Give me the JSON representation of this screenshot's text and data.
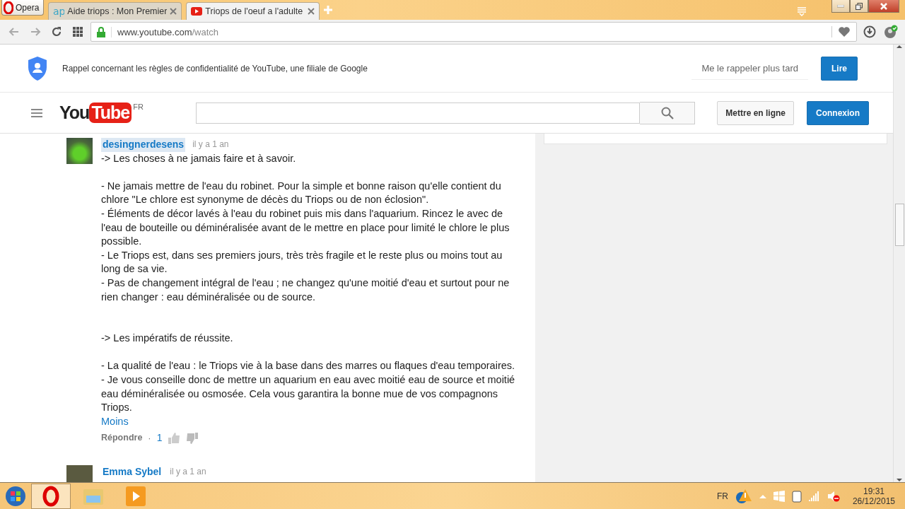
{
  "browser": {
    "menu_label": "Opera",
    "tabs": [
      {
        "title": "Aide triops : Mon Premier",
        "selected": false,
        "kind": "letters",
        "logo_text": "ap"
      },
      {
        "title": "Triops de l'oeuf a l'adulte",
        "selected": true,
        "kind": "video"
      }
    ],
    "url_domain": "www.youtube.com",
    "url_path": "/watch"
  },
  "privacy_banner": {
    "text": "Rappel concernant les règles de confidentialité de YouTube, une filiale de Google",
    "later": "Me le rappeler plus tard",
    "read": "Lire"
  },
  "header": {
    "logo_you": "You",
    "logo_tube": "Tube",
    "region": "FR",
    "upload": "Mettre en ligne",
    "signin": "Connexion"
  },
  "comments": [
    {
      "author": "desingnerdesens",
      "time": "il y a 1 an",
      "highlighted": true,
      "sections": [
        {
          "heading": "-> Les choses à ne jamais faire et à savoir.",
          "items": [
            "- Ne jamais mettre de l'eau du robinet. Pour la simple et bonne raison qu'elle contient du chlore \"Le chlore est synonyme de décès du Triops ou de non éclosion\".",
            "- Éléments de décor lavés à l'eau du robinet puis mis dans l'aquarium. Rincez le avec de l'eau de bouteille ou déminéralisée avant de le mettre en place pour limité le chlore le plus possible.",
            "- Le Triops est, dans ses premiers jours, très très fragile et le reste plus ou moins tout au long de sa vie.",
            "- Pas de changement intégral de l'eau ; ne changez qu'une moitié d'eau et surtout pour ne rien changer : eau déminéralisée ou de source."
          ]
        },
        {
          "heading": "-> Les impératifs de réussite.",
          "items": [
            "- La qualité de l'eau : le Triops vie à la base dans des marres ou flaques d'eau temporaires.",
            "- Je vous conseille donc de mettre un aquarium en eau avec moitié eau de source et moitié eau déminéralisée ou osmosée. Cela vous garantira la bonne mue de vos compagnons Triops."
          ]
        }
      ],
      "less": "Moins",
      "reply": "Répondre",
      "separator": "·",
      "likes": "1"
    },
    {
      "author": "Emma Sybel",
      "time": "il y a 1 an",
      "highlighted": false
    }
  ],
  "taskbar": {
    "language": "FR",
    "time": "19:31",
    "date": "26/12/2015"
  }
}
